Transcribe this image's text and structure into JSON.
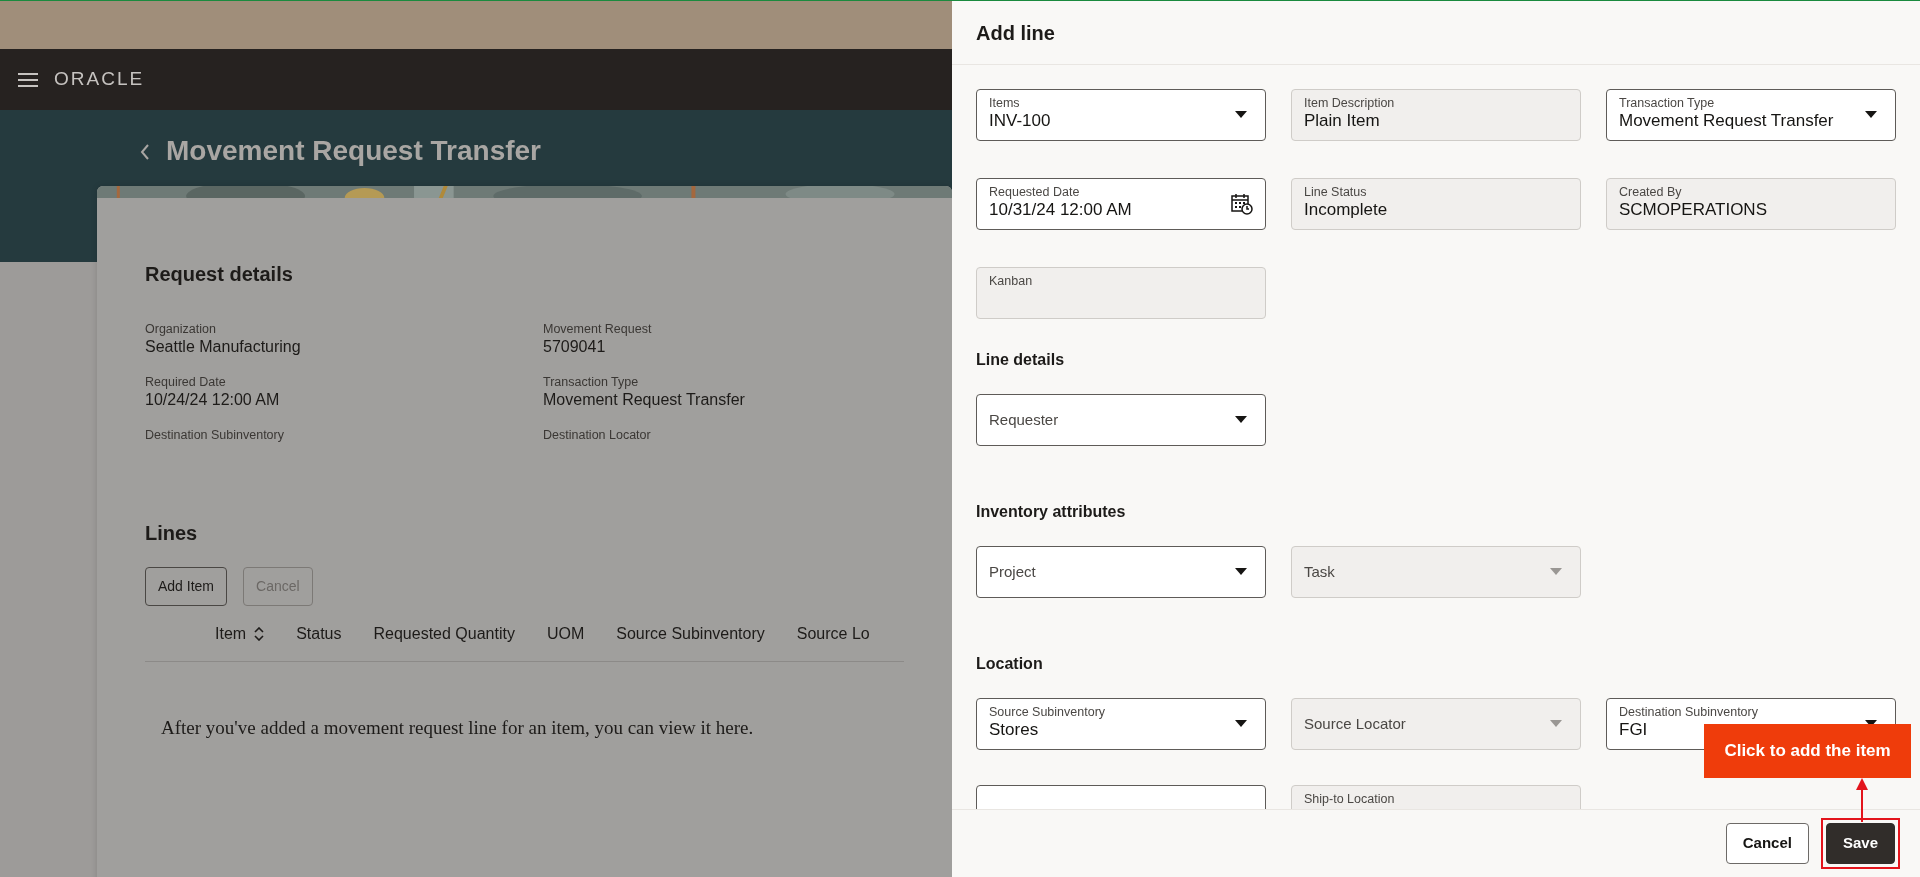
{
  "app_bar": {
    "logo": "ORACLE"
  },
  "page": {
    "title": "Movement Request Transfer",
    "details": {
      "title": "Request details",
      "fields": [
        {
          "label": "Organization",
          "value": "Seattle Manufacturing"
        },
        {
          "label": "Movement Request",
          "value": "5709041"
        },
        {
          "label": "Required Date",
          "value": "10/24/24 12:00 AM"
        },
        {
          "label": "Transaction Type",
          "value": "Movement Request Transfer"
        },
        {
          "label": "Destination Subinventory"
        },
        {
          "label": "Destination Locator"
        }
      ]
    },
    "lines": {
      "title": "Lines",
      "buttons": [
        {
          "label": "Add Item",
          "disabled": false
        },
        {
          "label": "Cancel",
          "disabled": true
        }
      ],
      "columns": [
        {
          "label": "Item",
          "sortable": true
        },
        {
          "label": "Status",
          "sortable": false
        },
        {
          "label": "Requested Quantity",
          "sortable": false
        },
        {
          "label": "UOM",
          "sortable": false
        },
        {
          "label": "Source Subinventory",
          "sortable": false
        },
        {
          "label": "Source Lo",
          "sortable": false
        }
      ],
      "empty_message": "After you've added a movement request line for an item, you can view it here."
    }
  },
  "drawer": {
    "title": "Add line",
    "sections": [
      {
        "rows": [
          [
            {
              "kind": "select",
              "label": "Items",
              "value": "INV-100",
              "readonly": false,
              "disabled": false
            },
            {
              "kind": "text",
              "label": "Item Description",
              "value": "Plain Item",
              "readonly": true
            },
            {
              "kind": "select",
              "label": "Transaction Type",
              "value": "Movement Request Transfer",
              "readonly": false,
              "disabled": false
            }
          ],
          [
            {
              "kind": "date",
              "label": "Requested Date",
              "value": "10/31/24 12:00 AM",
              "readonly": false
            },
            {
              "kind": "text",
              "label": "Line Status",
              "value": "Incomplete",
              "readonly": true
            },
            {
              "kind": "text",
              "label": "Created By",
              "value": "SCMOPERATIONS",
              "readonly": true
            }
          ],
          [
            {
              "kind": "text",
              "label": "Kanban",
              "readonly": true
            }
          ]
        ]
      },
      {
        "title": "Line details",
        "rows": [
          [
            {
              "kind": "select",
              "label": "Requester",
              "readonly": false,
              "disabled": false
            }
          ]
        ]
      },
      {
        "title": "Inventory attributes",
        "rows": [
          [
            {
              "kind": "select",
              "label": "Project",
              "readonly": false,
              "disabled": false
            },
            {
              "kind": "select",
              "label": "Task",
              "readonly": true,
              "disabled": true
            }
          ]
        ]
      },
      {
        "title": "Location",
        "rows": [
          [
            {
              "kind": "select",
              "label": "Source Subinventory",
              "value": "Stores",
              "readonly": false,
              "disabled": false
            },
            {
              "kind": "select",
              "label": "Source Locator",
              "readonly": true,
              "disabled": true
            },
            {
              "kind": "select",
              "label": "Destination Subinventory",
              "value": "FGI",
              "readonly": false
            }
          ],
          [
            {
              "kind": "text",
              "readonly": false
            },
            {
              "kind": "text",
              "label": "Ship-to Location",
              "readonly": true
            }
          ]
        ]
      }
    ],
    "buttons": [
      {
        "label": "Cancel",
        "primary": false
      },
      {
        "label": "Save",
        "primary": true
      }
    ]
  },
  "callout": {
    "text": "Click to add the item"
  }
}
